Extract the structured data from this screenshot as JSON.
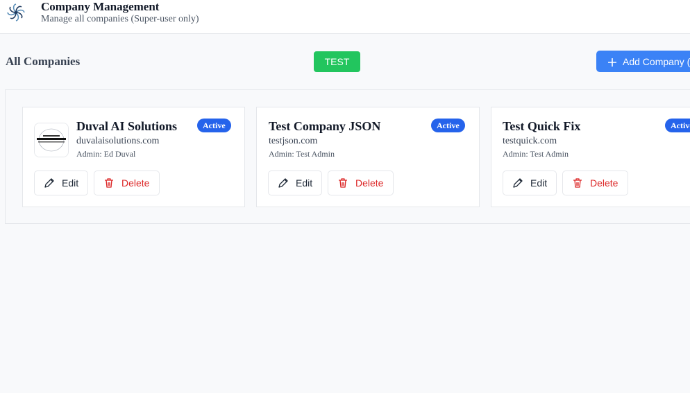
{
  "header": {
    "title": "Company Management",
    "subtitle": "Manage all companies (Super-user only)",
    "logo_icon": "spiral-flower-logo"
  },
  "toolbar": {
    "section_title": "All Companies",
    "test_label": "TEST",
    "add_label": "Add Company (",
    "add_icon": "plus-icon"
  },
  "colors": {
    "test_button": "#22c55e",
    "add_button": "#3b82f6",
    "badge": "#2563eb",
    "delete_text": "#dc2626"
  },
  "companies": [
    {
      "name": "Duval AI Solutions",
      "domain": "duvalaisolutions.com",
      "admin": "Admin: Ed Duval",
      "status": "Active",
      "has_logo": true,
      "edit_label": "Edit",
      "delete_label": "Delete"
    },
    {
      "name": "Test Company JSON",
      "domain": "testjson.com",
      "admin": "Admin: Test Admin",
      "status": "Active",
      "has_logo": false,
      "edit_label": "Edit",
      "delete_label": "Delete"
    },
    {
      "name": "Test Quick Fix",
      "domain": "testquick.com",
      "admin": "Admin: Test Admin",
      "status": "Active",
      "has_logo": false,
      "edit_label": "Edit",
      "delete_label": "Delete"
    }
  ]
}
